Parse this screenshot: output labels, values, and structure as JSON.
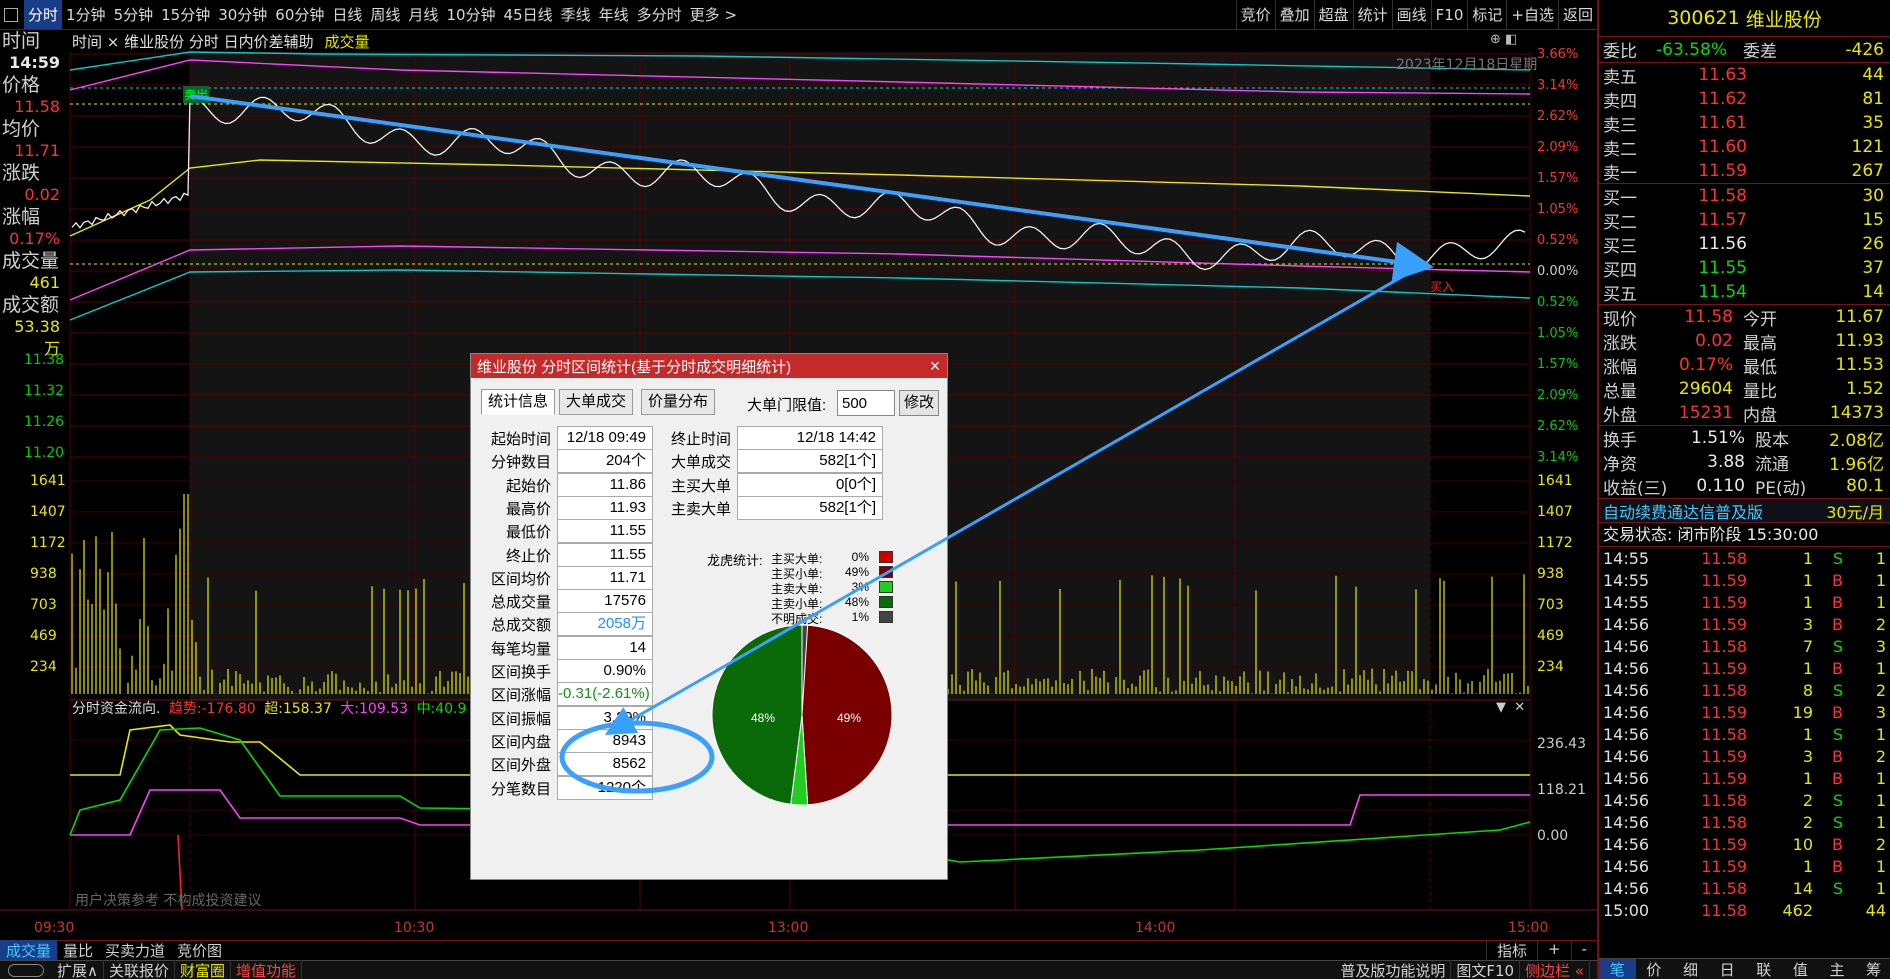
{
  "toolbar": {
    "periods": [
      "分时",
      "1分钟",
      "5分钟",
      "15分钟",
      "30分钟",
      "60分钟",
      "日线",
      "周线",
      "月线",
      "10分钟",
      "45日线",
      "季线",
      "年线",
      "多分时",
      "更多 >"
    ],
    "right_buttons": [
      "竞价",
      "叠加",
      "超盘",
      "统计",
      "画线",
      "F10",
      "标记",
      "+自选",
      "返回"
    ]
  },
  "chart": {
    "header": "时间  ×  维业股份  分时  日内价差辅助",
    "header_vol": "成交量",
    "date_watermark": "2023年12月18日星期",
    "left_labels": {
      "time_label": "时间",
      "time_value": "14:59",
      "price_label": "价格",
      "price_value": "11.58",
      "avg_label": "均价",
      "avg_value": "11.71",
      "chg_label": "涨跌",
      "chg_value": "0.02",
      "pct_label": "涨幅",
      "pct_value": "0.17%",
      "vol_label": "成交量",
      "vol_value": "461",
      "amt_label": "成交额",
      "amt_value": "53.38万"
    },
    "left_price_ticks": [
      "11.38",
      "11.32",
      "11.26",
      "11.20"
    ],
    "left_vol_ticks": [
      "1641",
      "1407",
      "1172",
      "938",
      "703",
      "469",
      "234"
    ],
    "right_pct_ticks": [
      "3.66%",
      "3.14%",
      "2.62%",
      "2.09%",
      "1.57%",
      "1.05%",
      "0.52%",
      "0.00%",
      "0.52%",
      "1.05%",
      "1.57%",
      "2.09%",
      "2.62%",
      "3.14%"
    ],
    "right_vol_ticks": [
      "1641",
      "1407",
      "1172",
      "938",
      "703",
      "469",
      "234"
    ],
    "flow_title": "分时资金流向.",
    "flow_trend_label": "趋势:",
    "flow_trend_value": "-176.80",
    "flow_super_label": "超:",
    "flow_super_value": "158.37",
    "flow_big_label": "大:",
    "flow_big_value": "109.53",
    "flow_mid_label": "中:",
    "flow_mid_value": "40.9",
    "flow_right_ticks": [
      "236.43",
      "118.21",
      "0.00"
    ],
    "flow_watermark": "不构成投资建议",
    "flow_watermark2": "用户决策参考",
    "time_axis": [
      "09:30",
      "10:30",
      "13:00",
      "14:00",
      "15:00"
    ],
    "marker_sell": "卖出",
    "marker_buy": "买入"
  },
  "bottom_tabs": [
    "成交量",
    "量比",
    "买卖力道",
    "竞价图"
  ],
  "bottom_right": [
    "指标",
    "+",
    "-"
  ],
  "status_bar": [
    "扩展∧",
    "关联报价",
    "财富圈",
    "增值功能"
  ],
  "status_right": [
    "普及版功能说明",
    "图文F10",
    "侧边栏 «"
  ],
  "panel": {
    "code": "300621",
    "name": "维业股份",
    "wb_label": "委比",
    "wb_value": "-63.58%",
    "wc_label": "委差",
    "wc_value": "-426",
    "asks": [
      {
        "label": "卖五",
        "price": "11.63",
        "vol": "44"
      },
      {
        "label": "卖四",
        "price": "11.62",
        "vol": "81"
      },
      {
        "label": "卖三",
        "price": "11.61",
        "vol": "35"
      },
      {
        "label": "卖二",
        "price": "11.60",
        "vol": "121"
      },
      {
        "label": "卖一",
        "price": "11.59",
        "vol": "267"
      }
    ],
    "bids": [
      {
        "label": "买一",
        "price": "11.58",
        "vol": "30"
      },
      {
        "label": "买二",
        "price": "11.57",
        "vol": "15"
      },
      {
        "label": "买三",
        "price": "11.56",
        "vol": "26"
      },
      {
        "label": "买四",
        "price": "11.55",
        "vol": "37"
      },
      {
        "label": "买五",
        "price": "11.54",
        "vol": "14"
      }
    ],
    "quote": [
      {
        "l1": "现价",
        "v1": "11.58",
        "l2": "今开",
        "v2": "11.67"
      },
      {
        "l1": "涨跌",
        "v1": "0.02",
        "l2": "最高",
        "v2": "11.93"
      },
      {
        "l1": "涨幅",
        "v1": "0.17%",
        "l2": "最低",
        "v2": "11.53"
      },
      {
        "l1": "总量",
        "v1": "29604",
        "l2": "量比",
        "v2": "1.52"
      },
      {
        "l1": "外盘",
        "v1": "15231",
        "l2": "内盘",
        "v2": "14373"
      }
    ],
    "fund": [
      {
        "l1": "换手",
        "v1": "1.51%",
        "l2": "股本",
        "v2": "2.08亿"
      },
      {
        "l1": "净资",
        "v1": "3.88",
        "l2": "流通",
        "v2": "1.96亿"
      },
      {
        "l1": "收益(三)",
        "v1": "0.110",
        "l2": "PE(动)",
        "v2": "80.1"
      }
    ],
    "ad_text": "自动续费通达信普及版",
    "ad_price": "30元/月",
    "trade_status": "交易状态: 闭市阶段 15:30:00",
    "ticks": [
      {
        "t": "14:55",
        "p": "11.58",
        "v": "1",
        "bs": "S",
        "n": "1"
      },
      {
        "t": "14:55",
        "p": "11.59",
        "v": "1",
        "bs": "B",
        "n": "1"
      },
      {
        "t": "14:55",
        "p": "11.59",
        "v": "1",
        "bs": "B",
        "n": "1"
      },
      {
        "t": "14:56",
        "p": "11.59",
        "v": "3",
        "bs": "B",
        "n": "2"
      },
      {
        "t": "14:56",
        "p": "11.58",
        "v": "7",
        "bs": "S",
        "n": "3"
      },
      {
        "t": "14:56",
        "p": "11.59",
        "v": "1",
        "bs": "B",
        "n": "1"
      },
      {
        "t": "14:56",
        "p": "11.58",
        "v": "8",
        "bs": "S",
        "n": "2"
      },
      {
        "t": "14:56",
        "p": "11.59",
        "v": "19",
        "bs": "B",
        "n": "3"
      },
      {
        "t": "14:56",
        "p": "11.58",
        "v": "1",
        "bs": "S",
        "n": "1"
      },
      {
        "t": "14:56",
        "p": "11.59",
        "v": "3",
        "bs": "B",
        "n": "2"
      },
      {
        "t": "14:56",
        "p": "11.59",
        "v": "1",
        "bs": "B",
        "n": "1"
      },
      {
        "t": "14:56",
        "p": "11.58",
        "v": "2",
        "bs": "S",
        "n": "1"
      },
      {
        "t": "14:56",
        "p": "11.58",
        "v": "2",
        "bs": "S",
        "n": "1"
      },
      {
        "t": "14:56",
        "p": "11.59",
        "v": "10",
        "bs": "B",
        "n": "2"
      },
      {
        "t": "14:56",
        "p": "11.59",
        "v": "1",
        "bs": "B",
        "n": "1"
      },
      {
        "t": "14:56",
        "p": "11.58",
        "v": "14",
        "bs": "S",
        "n": "1"
      },
      {
        "t": "15:00",
        "p": "11.58",
        "v": "462",
        "bs": "",
        "n": "44"
      }
    ],
    "bottom_tabs": [
      "笔",
      "价",
      "细",
      "日",
      "联",
      "值",
      "主",
      "筹"
    ]
  },
  "dialog": {
    "title": "维业股份 分时区间统计(基于分时成交明细统计)",
    "tabs": [
      "统计信息",
      "大单成交",
      "价量分布"
    ],
    "threshold_label": "大单门限值:",
    "threshold_value": "500",
    "modify_button": "修改",
    "fields": [
      {
        "label": "起始时间",
        "value": "12/18 09:49"
      },
      {
        "label": "分钟数目",
        "value": "204个"
      },
      {
        "label": "起始价",
        "value": "11.86"
      },
      {
        "label": "最高价",
        "value": "11.93"
      },
      {
        "label": "最低价",
        "value": "11.55"
      },
      {
        "label": "终止价",
        "value": "11.55"
      },
      {
        "label": "区间均价",
        "value": "11.71"
      },
      {
        "label": "总成交量",
        "value": "17576"
      },
      {
        "label": "总成交额",
        "value": "2058万"
      },
      {
        "label": "每笔均量",
        "value": "14"
      },
      {
        "label": "区间换手",
        "value": "0.90%"
      },
      {
        "label": "区间涨幅",
        "value": "-0.31(-2.61%)"
      },
      {
        "label": "区间振幅",
        "value": "3.29%"
      },
      {
        "label": "区间内盘",
        "value": "8943"
      },
      {
        "label": "区间外盘",
        "value": "8562"
      },
      {
        "label": "分笔数目",
        "value": "1220个"
      }
    ],
    "right_fields": [
      {
        "label": "终止时间",
        "value": "12/18 14:42"
      },
      {
        "label": "大单成交",
        "value": "582[1个]"
      },
      {
        "label": "主买大单",
        "value": "0[0个]"
      },
      {
        "label": "主卖大单",
        "value": "582[1个]"
      }
    ],
    "dragon_label": "龙虎统计:",
    "legend": [
      {
        "label": "主买大单:",
        "pct": "0%",
        "color": "#cc0000"
      },
      {
        "label": "主买小单:",
        "pct": "49%",
        "color": "#7a0000"
      },
      {
        "label": "主卖大单:",
        "pct": "3%",
        "color": "#22cc22"
      },
      {
        "label": "主卖小单:",
        "pct": "48%",
        "color": "#0a6a0a"
      },
      {
        "label": "不明成交:",
        "pct": "1%",
        "color": "#444444"
      }
    ],
    "pie_labels": {
      "left": "48%",
      "right": "49%"
    }
  }
}
